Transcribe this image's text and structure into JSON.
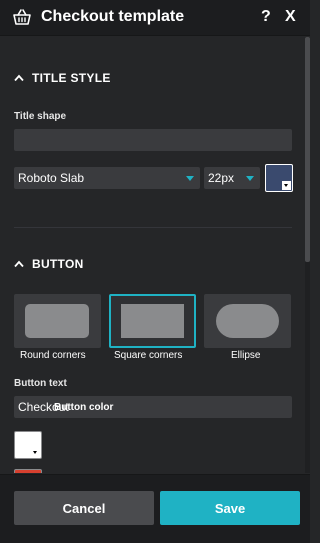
{
  "header": {
    "title": "Checkout template",
    "help_label": "?",
    "close_label": "X"
  },
  "title_style": {
    "heading": "TITLE STYLE",
    "shape_label": "Title shape",
    "shape_value": "",
    "font_value": "Roboto Slab",
    "size_value": "22px",
    "color": "#3a4a6e"
  },
  "button_section": {
    "heading": "BUTTON",
    "shapes": [
      {
        "label": "Round corners",
        "selected": false
      },
      {
        "label": "Square corners",
        "selected": true
      },
      {
        "label": "Ellipse",
        "selected": false
      }
    ],
    "text_label": "Button text",
    "text_value": "Checkout",
    "color_label": "Button color",
    "button_color": "#ffffff",
    "next_color": "#d6402f"
  },
  "footer": {
    "cancel_label": "Cancel",
    "save_label": "Save"
  },
  "colors": {
    "accent": "#1fb2c4",
    "panel_bg": "#252628",
    "header_bg": "#1c1d1f",
    "field_bg": "#3a3b3e"
  }
}
